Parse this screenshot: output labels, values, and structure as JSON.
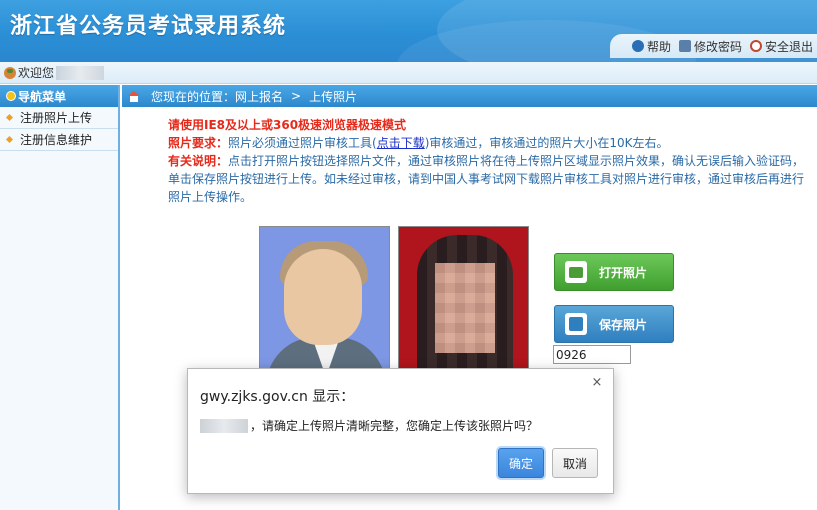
{
  "header": {
    "title": "浙江省公务员考试录用系统",
    "links": {
      "help": "帮助",
      "change_password": "修改密码",
      "logout": "安全退出"
    },
    "brand_color": "#2b8fd6"
  },
  "welcome": {
    "label": "欢迎您"
  },
  "sidebar": {
    "title": "导航菜单",
    "items": [
      {
        "label": "注册照片上传"
      },
      {
        "label": "注册信息维护"
      }
    ]
  },
  "breadcrumb": {
    "prefix": "您现在的位置：网上报名",
    "separator": ">",
    "current": "上传照片"
  },
  "notice": {
    "browser_tip": "请使用IE8及以上或360极速浏览器极速模式",
    "req_label": "照片要求：",
    "req_text_1": "照片必须通过照片审核工具(",
    "req_link": "点击下载",
    "req_text_2": ")审核通过，审核通过的照片大小在10K左右。",
    "info_label": "有关说明：",
    "info_text": "点击打开照片按钮选择照片文件，通过审核照片将在待上传照片区域显示照片效果，确认无误后输入验证码，单击保存照片按钮进行上传。如未经过审核，请到中国人事考试网下载照片审核工具对照片进行审核，通过审核后再进行照片上传操作。"
  },
  "actions": {
    "open_photo": "打开照片",
    "save_photo": "保存照片",
    "captcha_value": "0926"
  },
  "dialog": {
    "title": "gwy.zjks.gov.cn 显示：",
    "message": "，请确定上传照片清晰完整，您确定上传该张照片吗？",
    "ok": "确定",
    "cancel": "取消",
    "close": "×"
  }
}
